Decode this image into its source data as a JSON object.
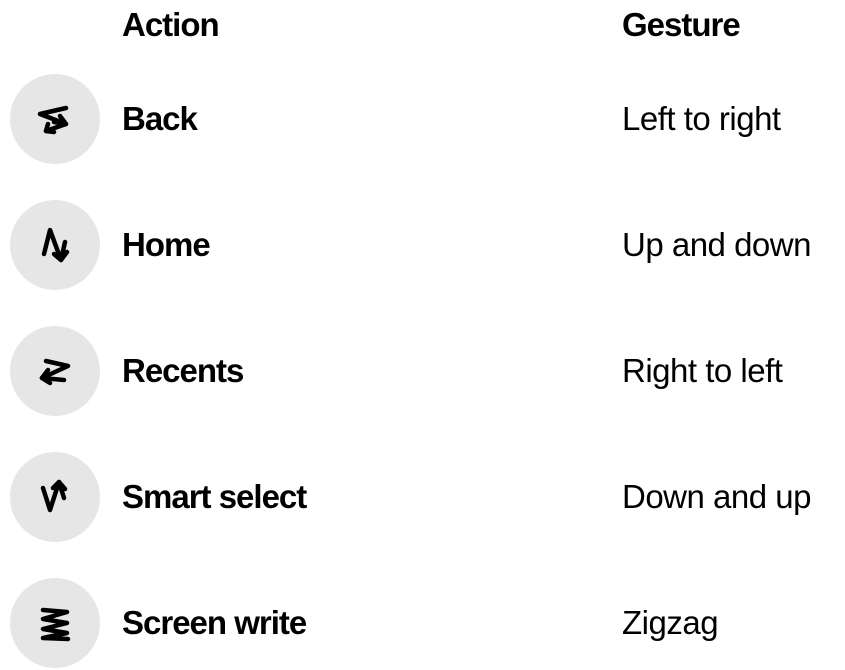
{
  "header": {
    "action_label": "Action",
    "gesture_label": "Gesture"
  },
  "rows": [
    {
      "action": "Back",
      "gesture": "Left to right",
      "icon": "back-gesture-icon"
    },
    {
      "action": "Home",
      "gesture": "Up and down",
      "icon": "home-gesture-icon"
    },
    {
      "action": "Recents",
      "gesture": "Right to left",
      "icon": "recents-gesture-icon"
    },
    {
      "action": "Smart select",
      "gesture": "Down and up",
      "icon": "smart-select-gesture-icon"
    },
    {
      "action": "Screen write",
      "gesture": "Zigzag",
      "icon": "screen-write-gesture-icon"
    }
  ],
  "colors": {
    "icon_background": "#e6e6e6",
    "text": "#000000"
  }
}
